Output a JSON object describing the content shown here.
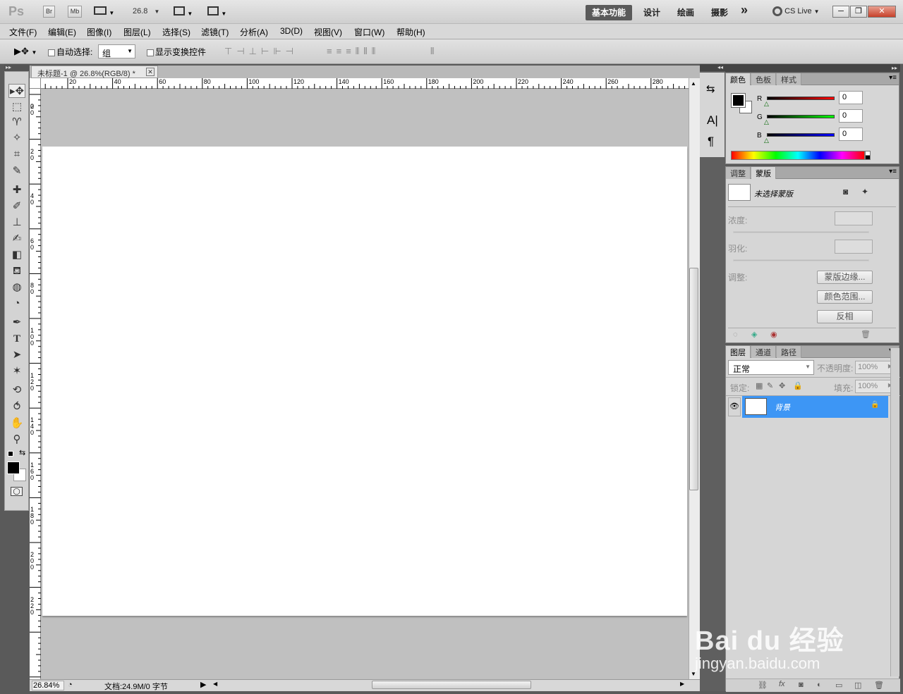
{
  "app": {
    "logo": "Ps",
    "bridge_label": "Br",
    "minibridge_label": "Mb",
    "zoom_value": "26.8",
    "workspaces": [
      "基本功能",
      "设计",
      "绘画",
      "摄影"
    ],
    "more": "»",
    "cs_live": "CS Live",
    "window_controls": [
      "─",
      "❐",
      "✕"
    ]
  },
  "menu": [
    "文件(F)",
    "编辑(E)",
    "图像(I)",
    "图层(L)",
    "选择(S)",
    "滤镜(T)",
    "分析(A)",
    "3D(D)",
    "视图(V)",
    "窗口(W)",
    "帮助(H)"
  ],
  "options": {
    "auto_select_label": "自动选择:",
    "auto_select_value": "组",
    "show_transform_label": "显示变换控件"
  },
  "document": {
    "tab_title": "未标题-1 @ 26.8%(RGB/8) *",
    "ruler_h": [
      "20",
      "40",
      "60",
      "80",
      "100",
      "120",
      "140",
      "160",
      "180",
      "200",
      "220",
      "240",
      "260",
      "280"
    ],
    "ruler_v": [
      "20",
      "0",
      "20",
      "40",
      "60",
      "80",
      "100",
      "120",
      "140",
      "160",
      "180",
      "200",
      "220"
    ],
    "zoom_status": "26.84%",
    "doc_info": "文档:24.9M/0 字节"
  },
  "color_panel": {
    "tabs": [
      "颜色",
      "色板",
      "样式"
    ],
    "r_label": "R",
    "g_label": "G",
    "b_label": "B",
    "r_value": "0",
    "g_value": "0",
    "b_value": "0",
    "colors": {
      "r": "#cc0000",
      "g": "#00b000",
      "b": "#0000cc"
    }
  },
  "mask_panel": {
    "tabs": [
      "调整",
      "蒙版"
    ],
    "no_mask": "未选择蒙版",
    "density_label": "浓度:",
    "feather_label": "羽化:",
    "adjust_label": "调整:",
    "mask_edge_btn": "蒙版边缘...",
    "color_range_btn": "颜色范围...",
    "invert_btn": "反相"
  },
  "layers_panel": {
    "tabs": [
      "图层",
      "通道",
      "路径"
    ],
    "blend_mode": "正常",
    "opacity_label": "不透明度:",
    "opacity_value": "100%",
    "lock_label": "锁定:",
    "fill_label": "填充:",
    "fill_value": "100%",
    "layer_name": "背景",
    "selected_color": "#3d96f5"
  },
  "watermark": {
    "brand": "Bai du 经验",
    "url": "jingyan.baidu.com"
  }
}
